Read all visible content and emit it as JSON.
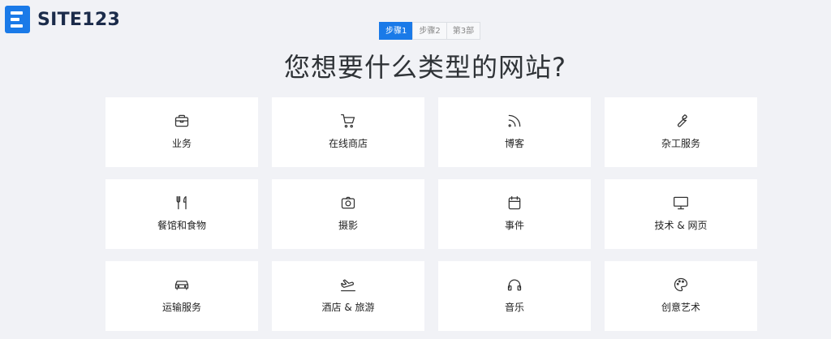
{
  "logo": {
    "text": "SITE123"
  },
  "steps": [
    {
      "label": "步骤1",
      "active": true
    },
    {
      "label": "步骤2",
      "active": false
    },
    {
      "label": "第3部",
      "active": false
    }
  ],
  "title": "您想要什么类型的网站?",
  "colors": {
    "accent": "#1a7ae8",
    "background": "#f1f2f6",
    "card": "#ffffff"
  },
  "categories": [
    {
      "label": "业务",
      "icon": "briefcase-icon"
    },
    {
      "label": "在线商店",
      "icon": "cart-icon"
    },
    {
      "label": "博客",
      "icon": "rss-icon"
    },
    {
      "label": "杂工服务",
      "icon": "wrench-icon"
    },
    {
      "label": "餐馆和食物",
      "icon": "fork-knife-icon"
    },
    {
      "label": "摄影",
      "icon": "camera-icon"
    },
    {
      "label": "事件",
      "icon": "calendar-icon"
    },
    {
      "label": "技术 & 网页",
      "icon": "monitor-icon"
    },
    {
      "label": "运输服务",
      "icon": "car-icon"
    },
    {
      "label": "酒店 & 旅游",
      "icon": "airplane-icon"
    },
    {
      "label": "音乐",
      "icon": "headphones-icon"
    },
    {
      "label": "创意艺术",
      "icon": "palette-icon"
    }
  ]
}
